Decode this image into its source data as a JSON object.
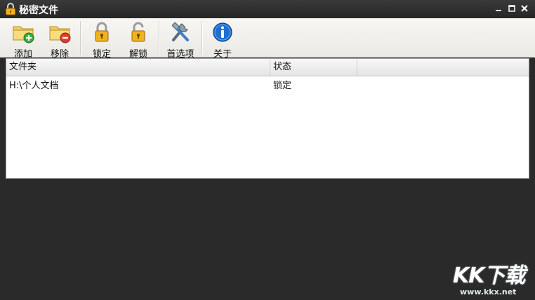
{
  "window": {
    "title": "秘密文件"
  },
  "toolbar": {
    "items": [
      {
        "label": "添加",
        "icon": "add-folder-icon"
      },
      {
        "label": "移除",
        "icon": "remove-folder-icon"
      },
      {
        "label": "锁定",
        "icon": "lock-icon"
      },
      {
        "label": "解锁",
        "icon": "unlock-icon"
      },
      {
        "label": "首选项",
        "icon": "tools-icon"
      },
      {
        "label": "关于",
        "icon": "info-icon"
      }
    ]
  },
  "list": {
    "columns": [
      "文件夹",
      "状态"
    ],
    "rows": [
      {
        "folder": "H:\\个人文档",
        "status": "锁定"
      }
    ]
  },
  "watermark": {
    "logo": "KK下载",
    "url": "www.kkx.net"
  },
  "colors": {
    "titlebar": "#2e2e2e",
    "toolbar": "#f0eeea",
    "list_bg": "#ffffff",
    "pane_bg": "#2a2a2a"
  }
}
